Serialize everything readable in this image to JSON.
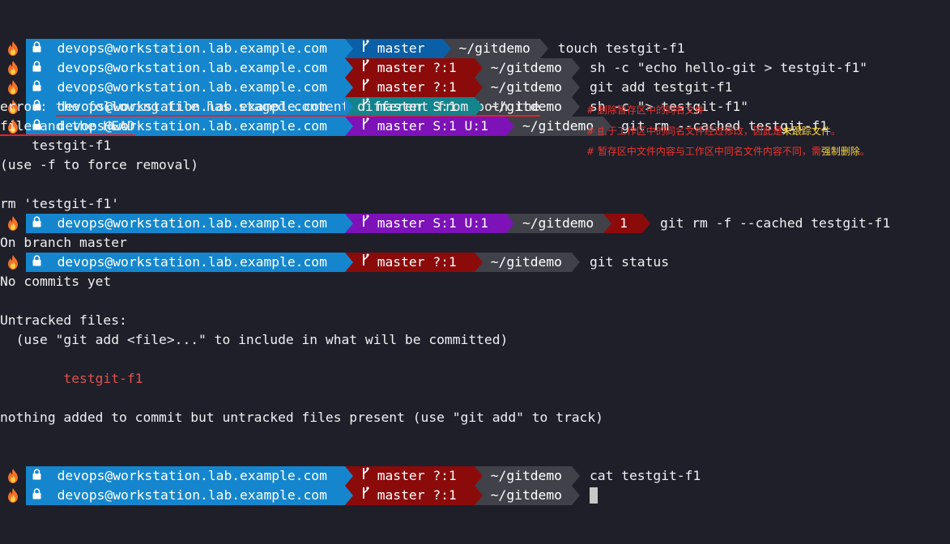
{
  "colors": {
    "background": "#1e1f29",
    "user_segment": "#1586cd",
    "git_clean": "#0b5fa6",
    "git_dirty": "#8b0b0b",
    "git_staged": "#13838c",
    "git_both": "#7c12b8",
    "path_segment": "#404149",
    "untracked_file": "#e0524d",
    "annotation": "#f0342e",
    "annotation_highlight": "#ffd43b"
  },
  "icons": {
    "prompt": "fire-icon",
    "lock": "lock-icon",
    "branch": "git-branch-icon"
  },
  "prompt": {
    "user": "devops@workstation.lab.example.com",
    "path": "~/gitdemo"
  },
  "prompts": [
    {
      "git": "master",
      "cmd": "touch testgit-f1"
    },
    {
      "git": "master ?:1",
      "cmd": "sh -c \"echo hello-git > testgit-f1\""
    },
    {
      "git": "master ?:1",
      "cmd": "git add testgit-f1"
    },
    {
      "git": "master S:1",
      "cmd": "sh -c \"> testgit-f1\""
    },
    {
      "git": "master S:1 U:1",
      "cmd": "git rm --cached testgit-f1"
    },
    {
      "git": "master S:1 U:1",
      "exit": "1",
      "cmd": "git rm -f --cached testgit-f1"
    },
    {
      "git": "master ?:1",
      "cmd": "git status"
    },
    {
      "git": "master ?:1",
      "cmd": "cat testgit-f1"
    },
    {
      "git": "master ?:1",
      "cmd": ""
    }
  ],
  "output": {
    "error_prefix": "error: ",
    "error_line1_ul": "the following file has staged content different from both the",
    "error_line2_ul": "file and the HEAD",
    "error_line2_tail": ":",
    "error_file": "    testgit-f1",
    "error_hint": "(use -f to force removal)",
    "rm_line": "rm 'testgit-f1'",
    "status_branch": "On branch master",
    "status_no_commits": "No commits yet",
    "status_untracked_header": "Untracked files:",
    "status_hint": "  (use \"git add <file>...\" to include in what will be committed)",
    "status_file": "        testgit-f1",
    "status_footer": "nothing added to commit but untracked files present (use \"git add\" to track)"
  },
  "annotations": {
    "line1": "# 删除暂存区中的同名文件",
    "line2_a": "# 由于工作区中的同名文件经过修改，因此是",
    "line2_hl": "未跟踪文件",
    "line2_b": "。",
    "line3_a": "# 暂存区中文件内容与工作区中同名文件内容不同，需",
    "line3_hl": "强制删除",
    "line3_b": "。"
  }
}
